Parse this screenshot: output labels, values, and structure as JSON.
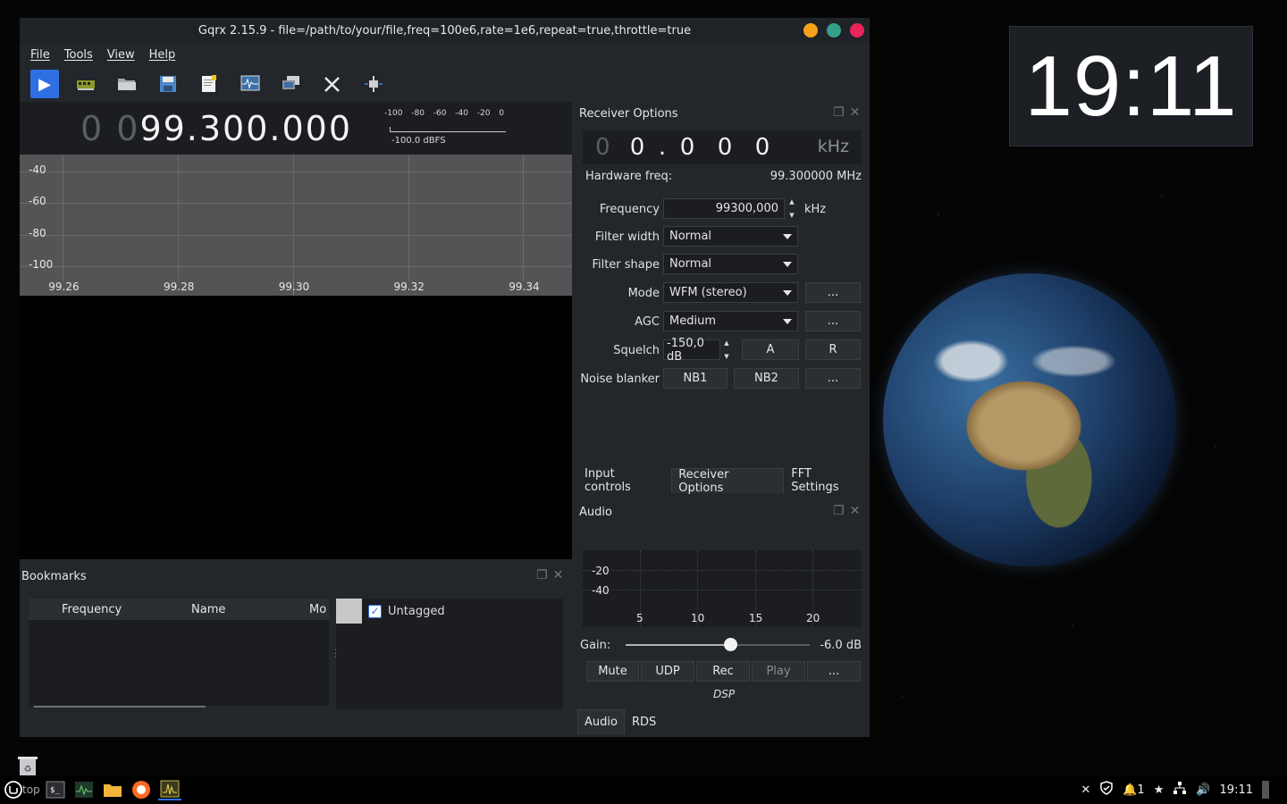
{
  "window": {
    "title": "Gqrx 2.15.9 - file=/path/to/your/file,freq=100e6,rate=1e6,repeat=true,throttle=true"
  },
  "desktop": {
    "clock": "19:11"
  },
  "menu": {
    "file": "File",
    "tools": "Tools",
    "view": "View",
    "help": "Help"
  },
  "toolbar": {
    "icons": [
      "play-icon",
      "hardware-icon",
      "open-file-icon",
      "save-icon",
      "load-settings-icon",
      "waterfall-icon",
      "remote-control-icon",
      "settings-icon",
      "center-icon"
    ]
  },
  "frequency_display": {
    "leading_dim": "0 0",
    "value": "99.300.000"
  },
  "smeter": {
    "scale": [
      "-100",
      "-80",
      "-60",
      "-40",
      "-20",
      "0"
    ],
    "reading": "-100.0 dBFS"
  },
  "chart_data": {
    "type": "line",
    "y_ticks": [
      "-40",
      "-60",
      "-80",
      "-100"
    ],
    "x_ticks": [
      "99.26",
      "99.28",
      "99.30",
      "99.32",
      "99.34"
    ],
    "x": [
      99.26,
      99.28,
      99.3,
      99.32,
      99.34
    ],
    "series": [],
    "ylim": [
      -110,
      -30
    ],
    "marker_freq": 99.3,
    "grid": true
  },
  "bookmarks": {
    "title": "Bookmarks",
    "columns": [
      "Frequency",
      "Name",
      "Mo"
    ],
    "rows": [],
    "tags": [
      {
        "name": "Untagged",
        "checked": true
      }
    ]
  },
  "receiver": {
    "title": "Receiver Options",
    "offset_digits": [
      "0",
      "0",
      ".",
      "0",
      "0",
      "0"
    ],
    "offset_unit": "kHz",
    "hardware_freq_label": "Hardware freq:",
    "hardware_freq_value": "99.300000 MHz",
    "frequency_label": "Frequency",
    "frequency_value": "99300,000",
    "frequency_unit": "kHz",
    "filter_width_label": "Filter width",
    "filter_width_value": "Normal",
    "filter_shape_label": "Filter shape",
    "filter_shape_value": "Normal",
    "mode_label": "Mode",
    "mode_value": "WFM (stereo)",
    "agc_label": "AGC",
    "agc_value": "Medium",
    "squelch_label": "Squelch",
    "squelch_value": "-150,0 dB",
    "squelch_a": "A",
    "squelch_r": "R",
    "noise_blanker_label": "Noise blanker",
    "nb1": "NB1",
    "nb2": "NB2",
    "more": "..."
  },
  "dock_tabs": {
    "input_controls": "Input controls",
    "receiver_options": "Receiver Options",
    "fft_settings": "FFT Settings"
  },
  "audio": {
    "title": "Audio",
    "y_ticks": [
      "-20",
      "-40"
    ],
    "x_ticks": [
      "5",
      "10",
      "15",
      "20"
    ],
    "gain_label": "Gain:",
    "gain_value": "-6.0 dB",
    "gain_fraction": 0.57,
    "mute": "Mute",
    "udp": "UDP",
    "rec": "Rec",
    "play": "Play",
    "more": "...",
    "dsp": "DSP"
  },
  "audio_tabs": {
    "audio": "Audio",
    "rds": "RDS"
  },
  "taskbar": {
    "desktop_label": "top",
    "tray_count": "1",
    "tray_time": "19:11"
  },
  "colors": {
    "accent": "#2f6fe4",
    "marker": "#e0505a",
    "min_btn": "#f6a21a",
    "max_btn": "#35a08a",
    "close_btn": "#e9245b"
  }
}
